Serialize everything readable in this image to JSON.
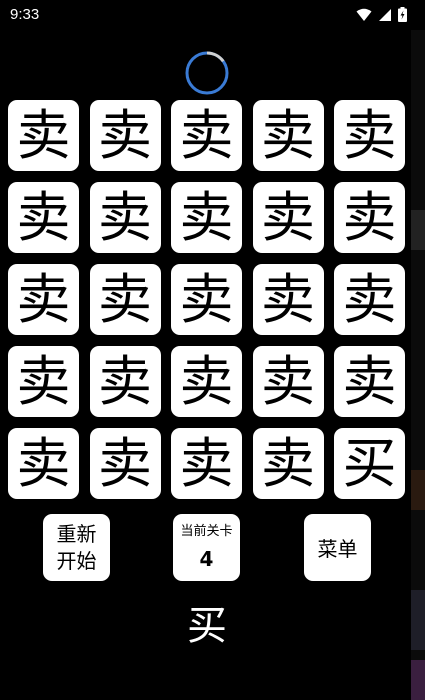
{
  "status_bar": {
    "time": "9:33",
    "icons": [
      "wifi-icon",
      "signal-icon",
      "battery-icon"
    ]
  },
  "timer": {
    "progress": 0.15,
    "color": "#3a7bd5"
  },
  "grid": {
    "rows": [
      [
        "卖",
        "卖",
        "卖",
        "卖",
        "卖"
      ],
      [
        "卖",
        "卖",
        "卖",
        "卖",
        "卖"
      ],
      [
        "卖",
        "卖",
        "卖",
        "卖",
        "卖"
      ],
      [
        "卖",
        "卖",
        "卖",
        "卖",
        "卖"
      ],
      [
        "卖",
        "卖",
        "卖",
        "卖",
        "买"
      ]
    ]
  },
  "controls": {
    "restart_line1": "重新",
    "restart_line2": "开始",
    "level_title": "当前关卡",
    "level_number": "4",
    "menu_label": "菜单"
  },
  "target": "买"
}
